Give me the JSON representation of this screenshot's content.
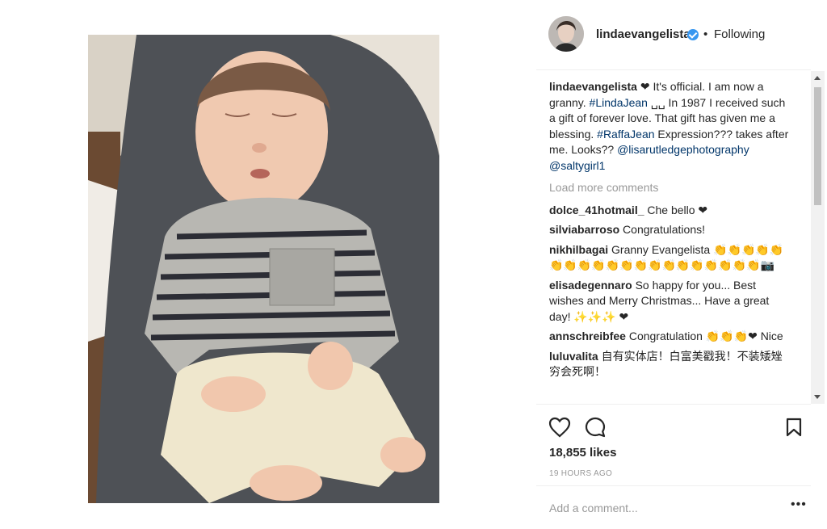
{
  "post": {
    "username": "linda evangelista",
    "header_username": "lindaevangelista",
    "dot": "•",
    "follow_status": "Following"
  },
  "caption": {
    "username": "lindaevangelista",
    "text_1": " It's official. I am now a granny. ",
    "tag_1": "#LindaJean",
    "text_2": " ␣␣ In 1987 I received such a gift of forever love. That gift has given me a blessing. ",
    "tag_2": "#RaffaJean",
    "text_3": " Expression??? takes after me. Looks?? ",
    "mention_1": "@lisarutledgephotography",
    "mention_2": "@saltygirl1"
  },
  "load_more": "Load more comments",
  "comments": [
    {
      "user": "dolce_41hotmail_",
      "text": "Che bello ❤"
    },
    {
      "user": "silviabarroso",
      "text": "Congratulations!"
    },
    {
      "user": "nikhilbagai",
      "text": "Granny Evangelista 👏👏👏👏👏👏👏👏👏👏👏👏👏👏👏👏👏👏👏👏📷"
    },
    {
      "user": "elisadegennaro",
      "text": "So happy for you... Best wishes and Merry Christmas... Have a great day! ✨✨✨ ❤"
    },
    {
      "user": "annschreibfee",
      "text": "Congratulation 👏👏👏❤ Nice"
    },
    {
      "user": "luluvalita",
      "text": "自有实体店！白富美戳我！不装矮矬穷会死啊！"
    }
  ],
  "likes": "18,855 likes",
  "time": "19 HOURS AGO",
  "add_comment_placeholder": "Add a comment...",
  "more_icon": "•••",
  "colors": {
    "link": "#003569",
    "verified": "#3897f0",
    "muted": "#999999"
  }
}
